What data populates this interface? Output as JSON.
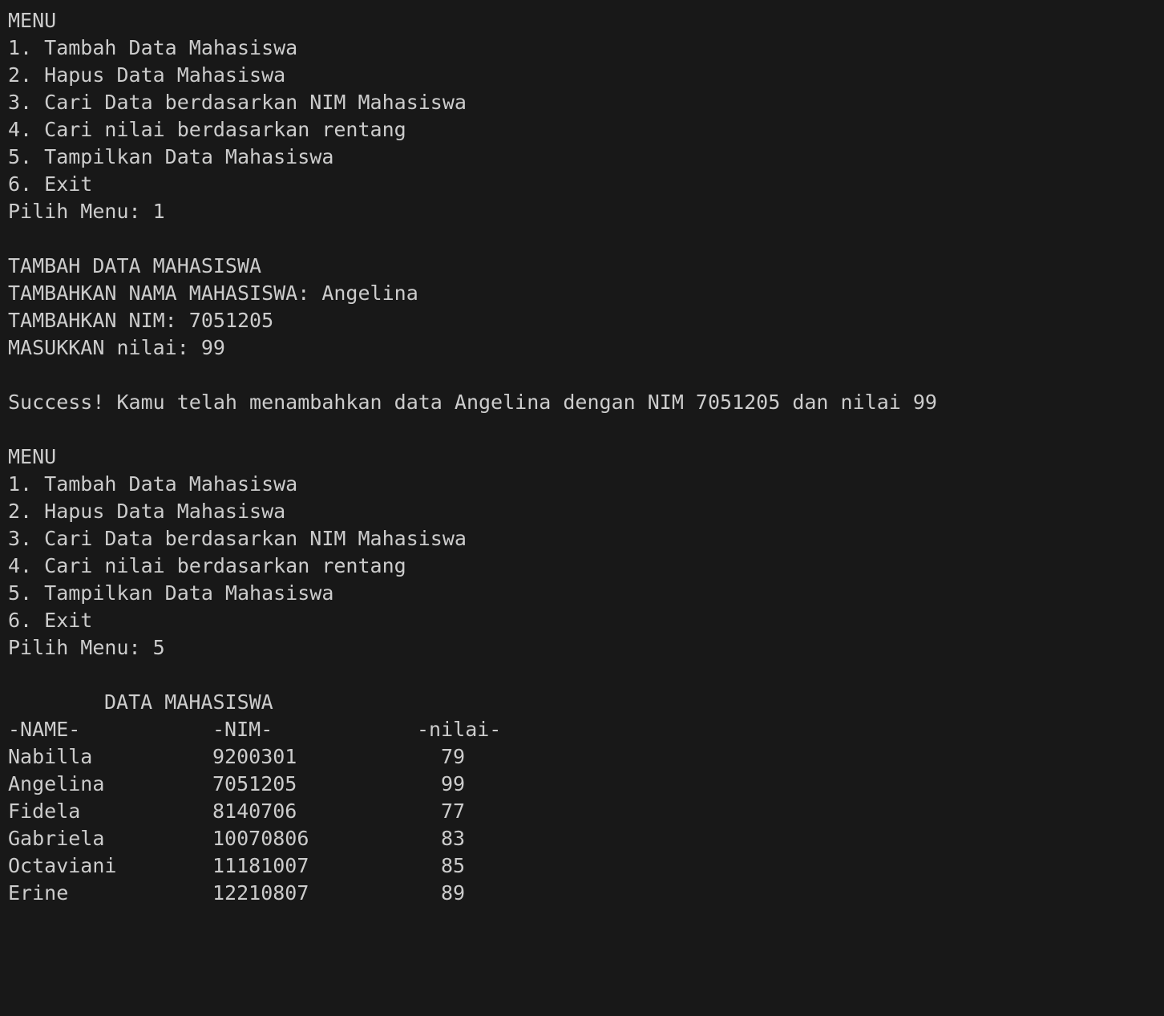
{
  "terminal": {
    "menu1": {
      "title": "MENU",
      "items": [
        "1. Tambah Data Mahasiswa",
        "2. Hapus Data Mahasiswa",
        "3. Cari Data berdasarkan NIM Mahasiswa",
        "4. Cari nilai berdasarkan rentang",
        "5. Tampilkan Data Mahasiswa",
        "6. Exit"
      ],
      "prompt": "Pilih Menu: 1"
    },
    "add": {
      "title": "TAMBAH DATA MAHASISWA",
      "name_prompt": "TAMBAHKAN NAMA MAHASISWA: Angelina",
      "nim_prompt": "TAMBAHKAN NIM: 7051205",
      "nilai_prompt": "MASUKKAN nilai: 99",
      "success": "Success! Kamu telah menambahkan data Angelina dengan NIM 7051205 dan nilai 99"
    },
    "menu2": {
      "title": "MENU",
      "items": [
        "1. Tambah Data Mahasiswa",
        "2. Hapus Data Mahasiswa",
        "3. Cari Data berdasarkan NIM Mahasiswa",
        "4. Cari nilai berdasarkan rentang",
        "5. Tampilkan Data Mahasiswa",
        "6. Exit"
      ],
      "prompt": "Pilih Menu: 5"
    },
    "table": {
      "title": "DATA MAHASISWA",
      "headers": [
        "-NAME-",
        "-NIM-",
        "-nilai-"
      ],
      "rows": [
        {
          "name": "Nabilla",
          "nim": "9200301",
          "nilai": "79"
        },
        {
          "name": "Angelina",
          "nim": "7051205",
          "nilai": "99"
        },
        {
          "name": "Fidela",
          "nim": "8140706",
          "nilai": "77"
        },
        {
          "name": "Gabriela",
          "nim": "10070806",
          "nilai": "83"
        },
        {
          "name": "Octaviani",
          "nim": "11181007",
          "nilai": "85"
        },
        {
          "name": "Erine",
          "nim": "12210807",
          "nilai": "89"
        }
      ]
    }
  }
}
